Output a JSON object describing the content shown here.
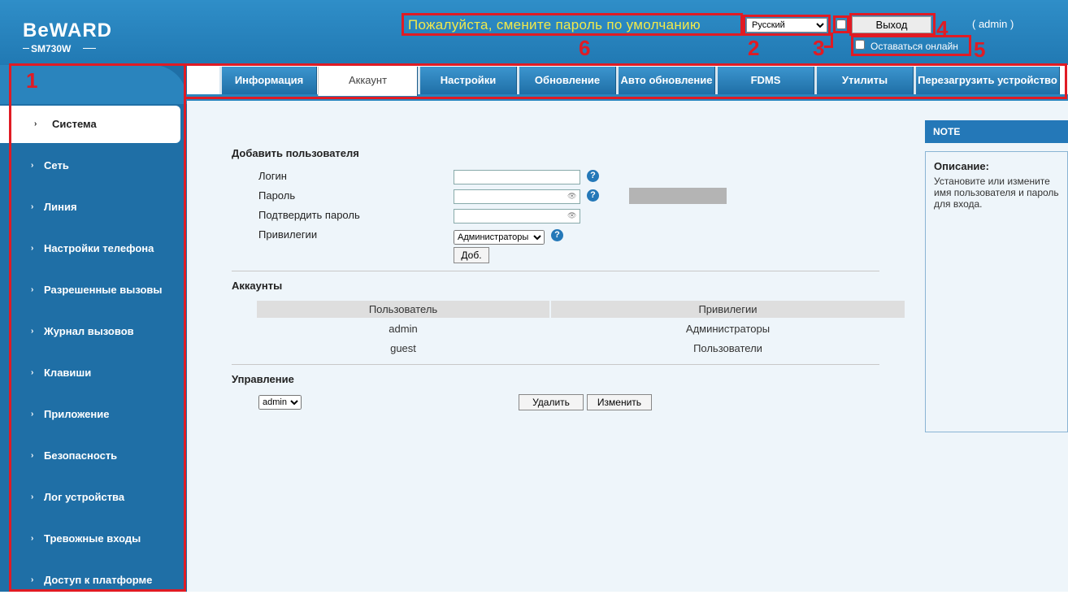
{
  "header": {
    "logo": "BeWARD",
    "model": "SM730W",
    "warning": "Пожалуйста, смените пароль по умолчанию",
    "language": "Русский",
    "logout_label": "Выход",
    "user_label": "( admin )",
    "stay_online_label": "Оставаться онлайн"
  },
  "annotations": [
    "1",
    "2",
    "3",
    "4",
    "5",
    "6"
  ],
  "sidebar": {
    "items": [
      {
        "label": "Система"
      },
      {
        "label": "Сеть"
      },
      {
        "label": "Линия"
      },
      {
        "label": "Настройки телефона"
      },
      {
        "label": "Разрешенные вызовы"
      },
      {
        "label": "Журнал вызовов"
      },
      {
        "label": "Клавиши"
      },
      {
        "label": "Приложение"
      },
      {
        "label": "Безопасность"
      },
      {
        "label": "Лог устройства"
      },
      {
        "label": "Тревожные входы"
      },
      {
        "label": "Доступ к платформе"
      }
    ]
  },
  "tabs": [
    {
      "label": "Информация"
    },
    {
      "label": "Аккаунт"
    },
    {
      "label": "Настройки"
    },
    {
      "label": "Обновление"
    },
    {
      "label": "Авто обновление"
    },
    {
      "label": "FDMS"
    },
    {
      "label": "Утилиты"
    },
    {
      "label": "Перезагрузить устройство"
    }
  ],
  "add_user": {
    "title": "Добавить пользователя",
    "login_label": "Логин",
    "password_label": "Пароль",
    "confirm_label": "Подтвердить пароль",
    "privileges_label": "Привилегии",
    "privileges_value": "Администраторы",
    "add_button": "Доб."
  },
  "accounts": {
    "title": "Аккаунты",
    "headers": [
      "Пользователь",
      "Привилегии"
    ],
    "rows": [
      [
        "admin",
        "Администраторы"
      ],
      [
        "guest",
        "Пользователи"
      ]
    ]
  },
  "management": {
    "title": "Управление",
    "selected_user": "admin",
    "delete_button": "Удалить",
    "edit_button": "Изменить"
  },
  "note": {
    "header": "NOTE",
    "title": "Описание:",
    "text": "Установите или измените имя пользователя и пароль для входа."
  }
}
